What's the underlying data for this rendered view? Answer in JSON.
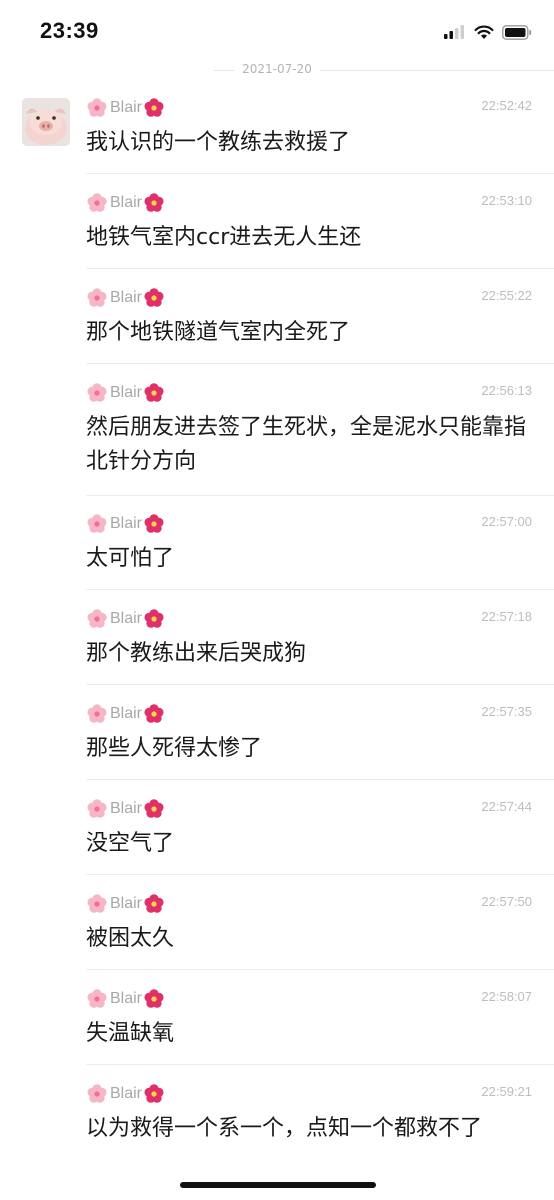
{
  "status": {
    "time": "23:39"
  },
  "date": "2021-07-20",
  "sender_name": "Blair",
  "messages": [
    {
      "time": "22:52:42",
      "text": "我认识的一个教练去救援了"
    },
    {
      "time": "22:53:10",
      "text": "地铁气室内ccr进去无人生还"
    },
    {
      "time": "22:55:22",
      "text": "那个地铁隧道气室内全死了"
    },
    {
      "time": "22:56:13",
      "text": "然后朋友进去签了生死状，全是泥水只能靠指北针分方向"
    },
    {
      "time": "22:57:00",
      "text": "太可怕了"
    },
    {
      "time": "22:57:18",
      "text": "那个教练出来后哭成狗"
    },
    {
      "time": "22:57:35",
      "text": "那些人死得太惨了"
    },
    {
      "time": "22:57:44",
      "text": "没空气了"
    },
    {
      "time": "22:57:50",
      "text": "被困太久"
    },
    {
      "time": "22:58:07",
      "text": "失温缺氧"
    },
    {
      "time": "22:59:21",
      "text": "以为救得一个系一个，点知一个都救不了"
    }
  ]
}
